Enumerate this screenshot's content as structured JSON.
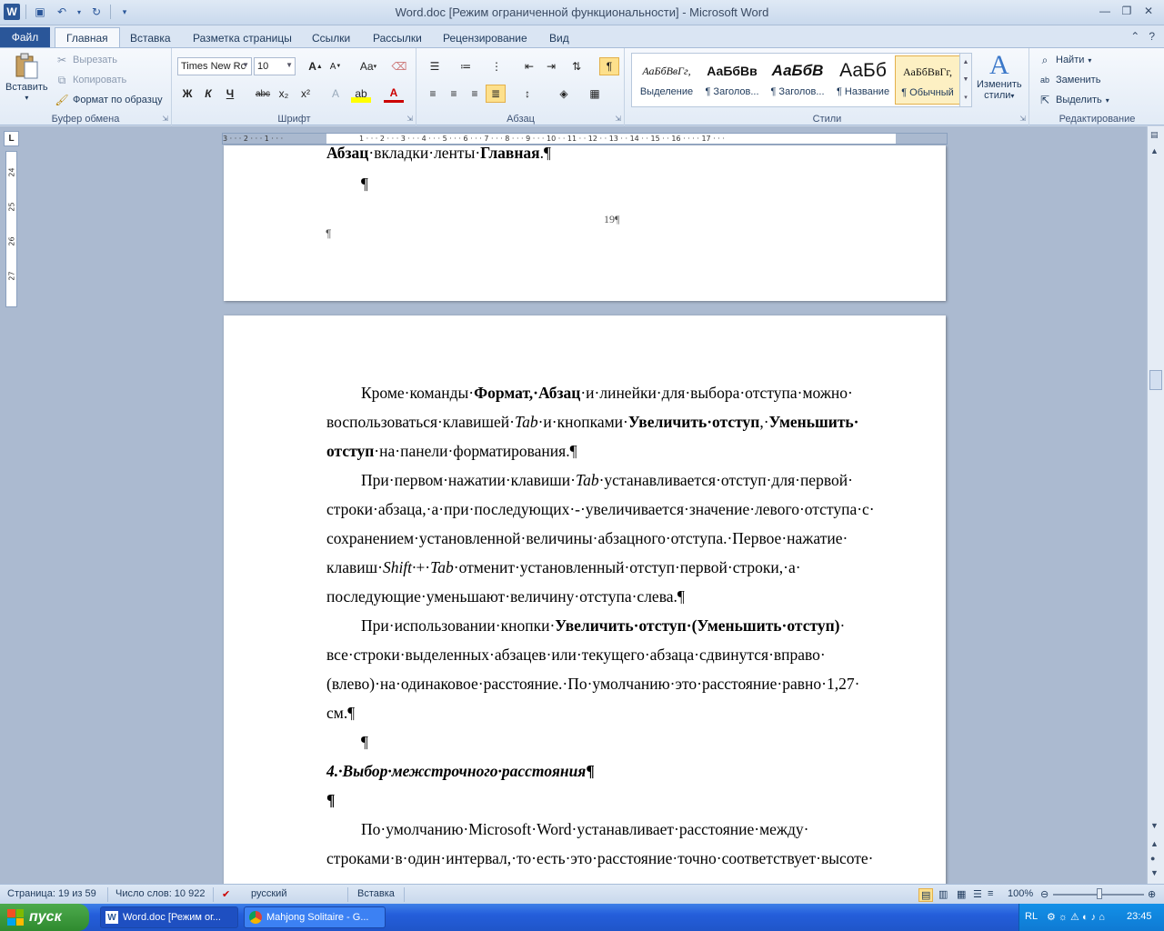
{
  "window": {
    "title": "Word.doc [Режим ограниченной функциональности]  -  Microsoft Word"
  },
  "tabs": {
    "file": "Файл",
    "items": [
      "Главная",
      "Вставка",
      "Разметка страницы",
      "Ссылки",
      "Рассылки",
      "Рецензирование",
      "Вид"
    ]
  },
  "ribbon": {
    "clipboard": {
      "paste": "Вставить",
      "cut": "Вырезать",
      "copy": "Копировать",
      "format_painter": "Формат по образцу",
      "label": "Буфер обмена"
    },
    "font": {
      "font_name": "Times New Rc",
      "font_size": "10",
      "bold": "Ж",
      "italic": "К",
      "underline": "Ч",
      "strike": "abc",
      "sub": "x₂",
      "sup": "x²",
      "case": "Aa",
      "grow": "A",
      "shrink": "A",
      "label": "Шрифт"
    },
    "paragraph": {
      "label": "Абзац"
    },
    "styles": {
      "items": [
        {
          "preview": "АаБбВвГг,",
          "name": "Выделение"
        },
        {
          "preview": "АаБбВв",
          "name": "¶ Заголов..."
        },
        {
          "preview": "АаБбВ",
          "name": "¶ Заголов..."
        },
        {
          "preview": "АаБб",
          "name": "¶ Название"
        },
        {
          "preview": "АаБбВвГг,",
          "name": "¶ Обычный"
        }
      ],
      "change_line1": "Изменить",
      "change_line2": "стили",
      "label": "Стили"
    },
    "editing": {
      "find": "Найти",
      "replace": "Заменить",
      "select": "Выделить",
      "label": "Редактирование"
    }
  },
  "document": {
    "page1": {
      "line1_bold1": "Абзац",
      "line1_mid": "·вкладки·ленты·",
      "line1_bold2": "Главная",
      "line1_end": ".¶",
      "empty": "¶",
      "page_number": "19¶",
      "end_mark": "¶"
    },
    "page2": {
      "p1_l1": [
        {
          "t": "Кроме·команды·",
          "s": ""
        },
        {
          "t": "Формат,·Абзац",
          "s": "b"
        },
        {
          "t": "·и·линейки·для·выбора·отступа·можно·",
          "s": ""
        }
      ],
      "p1_l2": [
        {
          "t": "воспользоваться·клавишей·",
          "s": ""
        },
        {
          "t": "Tab",
          "s": "i"
        },
        {
          "t": "·и·кнопками·",
          "s": ""
        },
        {
          "t": "Увеличить·отступ",
          "s": "b"
        },
        {
          "t": ",·",
          "s": ""
        },
        {
          "t": "Уменьшить·",
          "s": "b"
        }
      ],
      "p1_l3_bold": "отступ",
      "p1_l3": "·на·панели·форматирования.¶",
      "p2_l1": [
        {
          "t": "При·первом·нажатии·клавиши·",
          "s": ""
        },
        {
          "t": "Tab",
          "s": "i"
        },
        {
          "t": "·устанавливается·отступ·для·первой·",
          "s": ""
        }
      ],
      "p2_l2": "строки·абзаца,·а·при·последующих·-·увеличивается·значение·левого·отступа·с·",
      "p2_l3": "сохранением·установленной·величины·абзацного·отступа.·Первое·нажатие·",
      "p2_l4": [
        {
          "t": "клавиш·",
          "s": ""
        },
        {
          "t": "Shift·",
          "s": "i"
        },
        {
          "t": "+·",
          "s": ""
        },
        {
          "t": "Tab",
          "s": "i"
        },
        {
          "t": "·отменит·установленный·отступ·первой·строки,·а·",
          "s": ""
        }
      ],
      "p2_l5": "последующие·уменьшают·величину·отступа·слева.¶",
      "p3_l1": [
        {
          "t": "При·использовании·кнопки·",
          "s": ""
        },
        {
          "t": "Увеличить·отступ·(Уменьшить·отступ)",
          "s": "b"
        },
        {
          "t": "·",
          "s": ""
        }
      ],
      "p3_l2": "все·строки·выделенных·абзацев·или·текущего·абзаца·сдвинутся·вправо·",
      "p3_l3": "(влево)·на·одинаковое·расстояние.·По·умолчанию·это·расстояние·равно·1,27·",
      "p3_l4": "см.¶",
      "empty1": "¶",
      "heading": "4.·Выбор·межстрочного·расстояния",
      "heading_mark": "¶",
      "empty2": "¶",
      "p4_l1": "По·умолчанию·Microsoft·Word·устанавливает·расстояние·между·",
      "p4_l2": "строками·в·один·интервал,·то·есть·это·расстояние·точно·соответствует·высоте·"
    }
  },
  "statusbar": {
    "page": "Страница: 19 из 59",
    "words": "Число слов: 10 922",
    "language": "русский",
    "mode": "Вставка",
    "zoom": "100%"
  },
  "taskbar": {
    "start": "пуск",
    "tasks": [
      "Word.doc [Режим ог...",
      "Mahjong Solitaire - G..."
    ],
    "lang": "RL",
    "time": "23:45"
  }
}
